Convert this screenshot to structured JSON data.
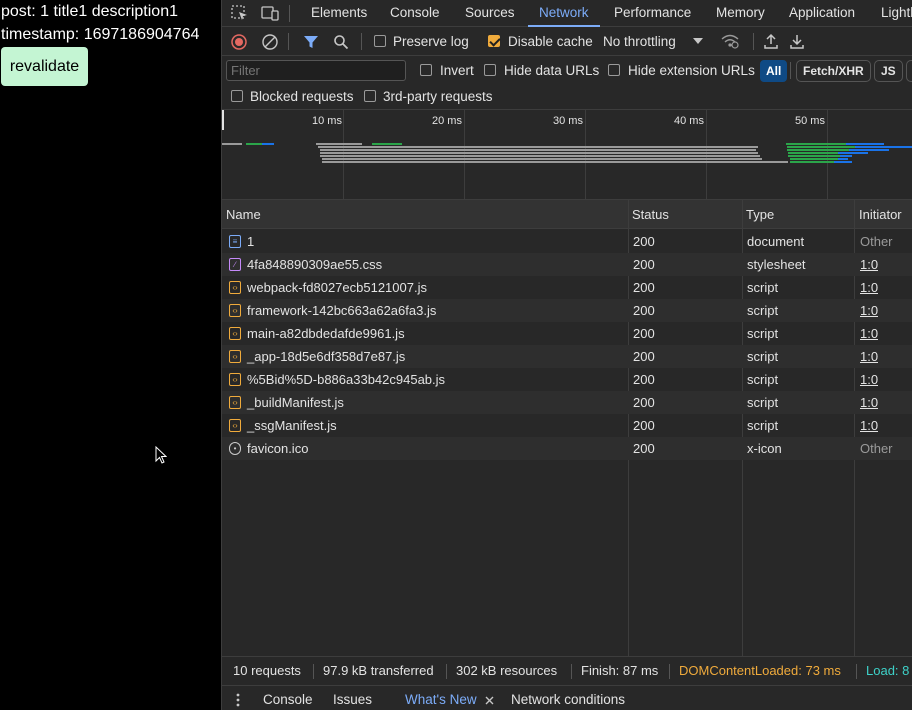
{
  "page": {
    "post_line": "post: 1 title1 description1",
    "timestamp_line": "timestamp: 1697186904764",
    "revalidate_label": "revalidate"
  },
  "devtools": {
    "tabs": [
      "Elements",
      "Console",
      "Sources",
      "Network",
      "Performance",
      "Memory",
      "Application",
      "Lighth"
    ],
    "active_tab": "Network",
    "toolbar": {
      "preserve_log": "Preserve log",
      "preserve_log_checked": false,
      "disable_cache": "Disable cache",
      "disable_cache_checked": true,
      "throttling": "No throttling"
    },
    "filter_bar": {
      "filter_placeholder": "Filter",
      "invert": "Invert",
      "hide_data_urls": "Hide data URLs",
      "hide_extension_urls": "Hide extension URLs",
      "type_filters": [
        "All",
        "Fetch/XHR",
        "JS"
      ],
      "active_type_filter": "All"
    },
    "filter_bar2": {
      "blocked_requests": "Blocked requests",
      "third_party_requests": "3rd-party requests"
    },
    "overview": {
      "tick_labels": [
        "10 ms",
        "20 ms",
        "30 ms",
        "40 ms",
        "50 ms"
      ]
    },
    "table": {
      "columns": [
        "Name",
        "Status",
        "Type",
        "Initiator"
      ],
      "rows": [
        {
          "name": "1",
          "status": "200",
          "type": "document",
          "initiator": "Other",
          "icon": "document-icon"
        },
        {
          "name": "4fa848890309ae55.css",
          "status": "200",
          "type": "stylesheet",
          "initiator": "1:0",
          "icon": "stylesheet-icon"
        },
        {
          "name": "webpack-fd8027ecb5121007.js",
          "status": "200",
          "type": "script",
          "initiator": "1:0",
          "icon": "script-icon"
        },
        {
          "name": "framework-142bc663a62a6fa3.js",
          "status": "200",
          "type": "script",
          "initiator": "1:0",
          "icon": "script-icon"
        },
        {
          "name": "main-a82dbdedafde9961.js",
          "status": "200",
          "type": "script",
          "initiator": "1:0",
          "icon": "script-icon"
        },
        {
          "name": "_app-18d5e6df358d7e87.js",
          "status": "200",
          "type": "script",
          "initiator": "1:0",
          "icon": "script-icon"
        },
        {
          "name": "%5Bid%5D-b886a33b42c945ab.js",
          "status": "200",
          "type": "script",
          "initiator": "1:0",
          "icon": "script-icon"
        },
        {
          "name": "_buildManifest.js",
          "status": "200",
          "type": "script",
          "initiator": "1:0",
          "icon": "script-icon"
        },
        {
          "name": "_ssgManifest.js",
          "status": "200",
          "type": "script",
          "initiator": "1:0",
          "icon": "script-icon"
        },
        {
          "name": "favicon.ico",
          "status": "200",
          "type": "x-icon",
          "initiator": "Other",
          "icon": "favicon-icon"
        }
      ]
    },
    "status_bar": {
      "requests": "10 requests",
      "transferred": "97.9 kB transferred",
      "resources": "302 kB resources",
      "finish": "Finish: 87 ms",
      "dom_content_loaded": "DOMContentLoaded: 73 ms",
      "load": "Load: 8"
    },
    "drawer": {
      "tabs": [
        "Console",
        "Issues",
        "What's New",
        "Network conditions"
      ],
      "active_tab": "What's New"
    },
    "colors": {
      "active_tab": "#7cacf8",
      "dom_content_loaded": "#f0ab3c",
      "load": "#3ed1c8",
      "revalidate_bg": "#c4f5d3"
    }
  }
}
